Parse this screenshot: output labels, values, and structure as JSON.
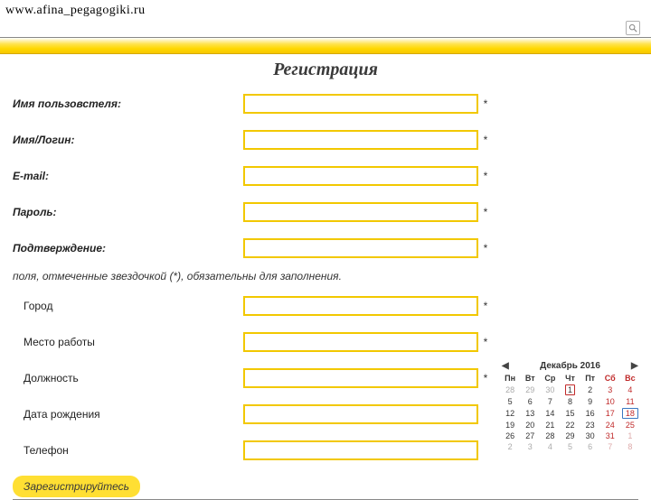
{
  "url": "www.afina_pegagogiki.ru",
  "title": "Регистрация",
  "fields": {
    "username": {
      "label": "Имя пользовстеля:",
      "required": true
    },
    "login": {
      "label": "Имя/Логин:",
      "required": true
    },
    "email": {
      "label": "E-mail:",
      "required": true
    },
    "password": {
      "label": "Пароль:",
      "required": true
    },
    "confirm": {
      "label": "Подтверждение:",
      "required": true
    },
    "city": {
      "label": "Город",
      "required": true
    },
    "workplace": {
      "label": "Место работы",
      "required": true
    },
    "position": {
      "label": "Должность",
      "required": true
    },
    "birthdate": {
      "label": "Дата рождения",
      "required": false
    },
    "phone": {
      "label": "Телефон",
      "required": false
    }
  },
  "required_note": "поля, отмеченные звездочкой (*), обязательны для заполнения.",
  "register_button": "Зарегистрируйтесь",
  "star": "*",
  "calendar": {
    "title": "Декабрь 2016",
    "weekdays": [
      "Пн",
      "Вт",
      "Ср",
      "Чт",
      "Пт",
      "Сб",
      "Вс"
    ],
    "weeks": [
      [
        {
          "d": 28,
          "m": true
        },
        {
          "d": 29,
          "m": true
        },
        {
          "d": 30,
          "m": true
        },
        {
          "d": 1,
          "t": true
        },
        {
          "d": 2
        },
        {
          "d": 3,
          "w": true
        },
        {
          "d": 4,
          "w": true
        }
      ],
      [
        {
          "d": 5
        },
        {
          "d": 6
        },
        {
          "d": 7
        },
        {
          "d": 8
        },
        {
          "d": 9
        },
        {
          "d": 10,
          "w": true
        },
        {
          "d": 11,
          "w": true
        }
      ],
      [
        {
          "d": 12
        },
        {
          "d": 13
        },
        {
          "d": 14
        },
        {
          "d": 15
        },
        {
          "d": 16
        },
        {
          "d": 17,
          "w": true
        },
        {
          "d": 18,
          "w": true,
          "s": true
        }
      ],
      [
        {
          "d": 19
        },
        {
          "d": 20
        },
        {
          "d": 21
        },
        {
          "d": 22
        },
        {
          "d": 23
        },
        {
          "d": 24,
          "w": true
        },
        {
          "d": 25,
          "w": true
        }
      ],
      [
        {
          "d": 26
        },
        {
          "d": 27
        },
        {
          "d": 28
        },
        {
          "d": 29
        },
        {
          "d": 30
        },
        {
          "d": 31,
          "w": true
        },
        {
          "d": 1,
          "m": true,
          "w": true
        }
      ],
      [
        {
          "d": 2,
          "m": true
        },
        {
          "d": 3,
          "m": true
        },
        {
          "d": 4,
          "m": true
        },
        {
          "d": 5,
          "m": true
        },
        {
          "d": 6,
          "m": true
        },
        {
          "d": 7,
          "m": true,
          "w": true
        },
        {
          "d": 8,
          "m": true,
          "w": true
        }
      ]
    ]
  }
}
